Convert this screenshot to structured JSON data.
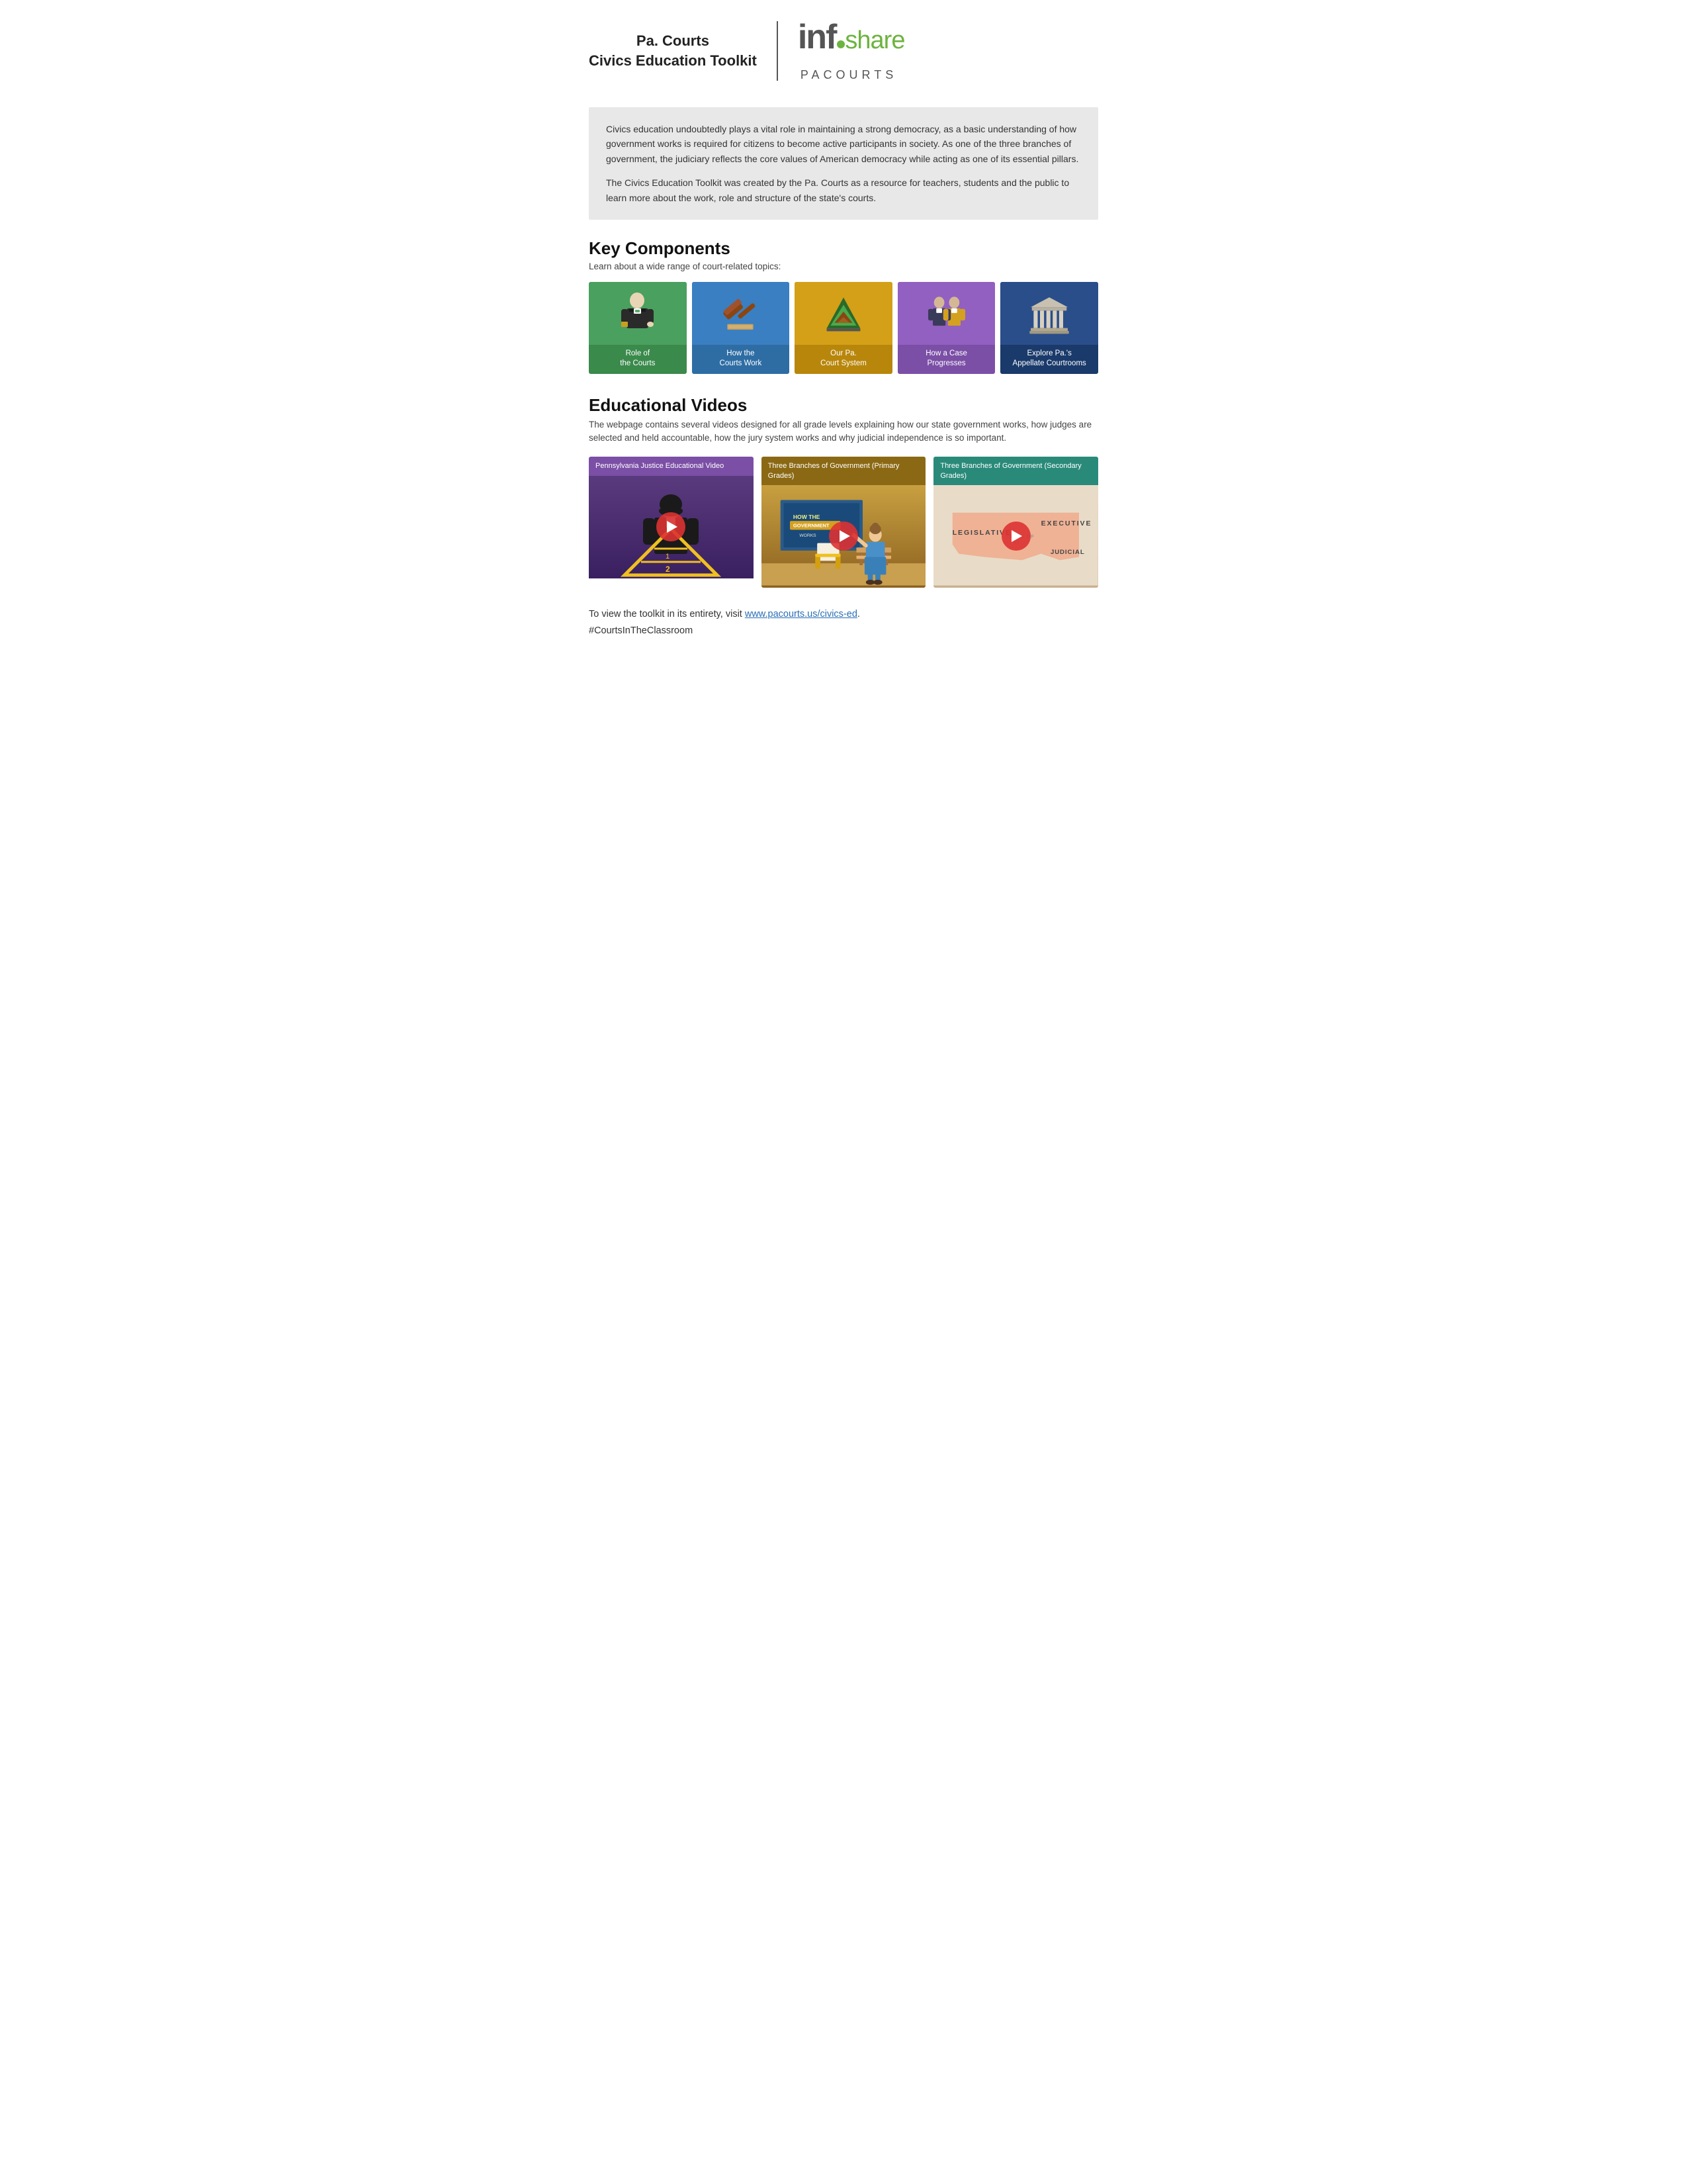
{
  "header": {
    "title_line1": "Pa. Courts",
    "title_line2": "Civics Education Toolkit",
    "logo_info": "info",
    "logo_share": "share",
    "logo_pacourts": "PACOURTS"
  },
  "intro": {
    "paragraph1": "Civics education undoubtedly plays a vital role in maintaining a strong democracy, as a basic understanding of how government works is required for citizens to become active participants in society. As one of the three branches of government, the judiciary reflects the core values of American democracy while acting as one of its essential pillars.",
    "paragraph2": "The Civics Education Toolkit was created by the Pa. Courts as a resource for teachers, students and the public to learn more about the work, role and structure of the state's courts."
  },
  "key_components": {
    "title": "Key Components",
    "subtitle": "Learn about a wide range of court-related topics:",
    "cards": [
      {
        "label": "Role of\nthe Courts",
        "color": "green"
      },
      {
        "label": "How the\nCourts Work",
        "color": "blue"
      },
      {
        "label": "Our Pa.\nCourt System",
        "color": "gold"
      },
      {
        "label": "How a Case\nProgresses",
        "color": "purple"
      },
      {
        "label": "Explore Pa.'s\nAppellate Courtrooms",
        "color": "darkblue"
      }
    ]
  },
  "educational_videos": {
    "title": "Educational Videos",
    "subtitle": "The webpage contains several videos designed for all grade levels explaining how our state government works, how judges are selected and held accountable, how the jury system works and why judicial independence is so important.",
    "videos": [
      {
        "title": "Pennsylvania Justice Educational Video",
        "color": "purple"
      },
      {
        "title": "Three Branches of Government\n(Primary Grades)",
        "color": "gold"
      },
      {
        "title": "Three Branches of Government\n(Secondary Grades)",
        "color": "teal"
      }
    ]
  },
  "footer": {
    "text": "To view the toolkit in its entirety, visit ",
    "link_text": "www.pacourts.us/civics-ed",
    "link_url": "http://www.pacourts.us/civics-ed",
    "after_link": ".",
    "hashtag": "#CourtsInTheClassroom"
  }
}
